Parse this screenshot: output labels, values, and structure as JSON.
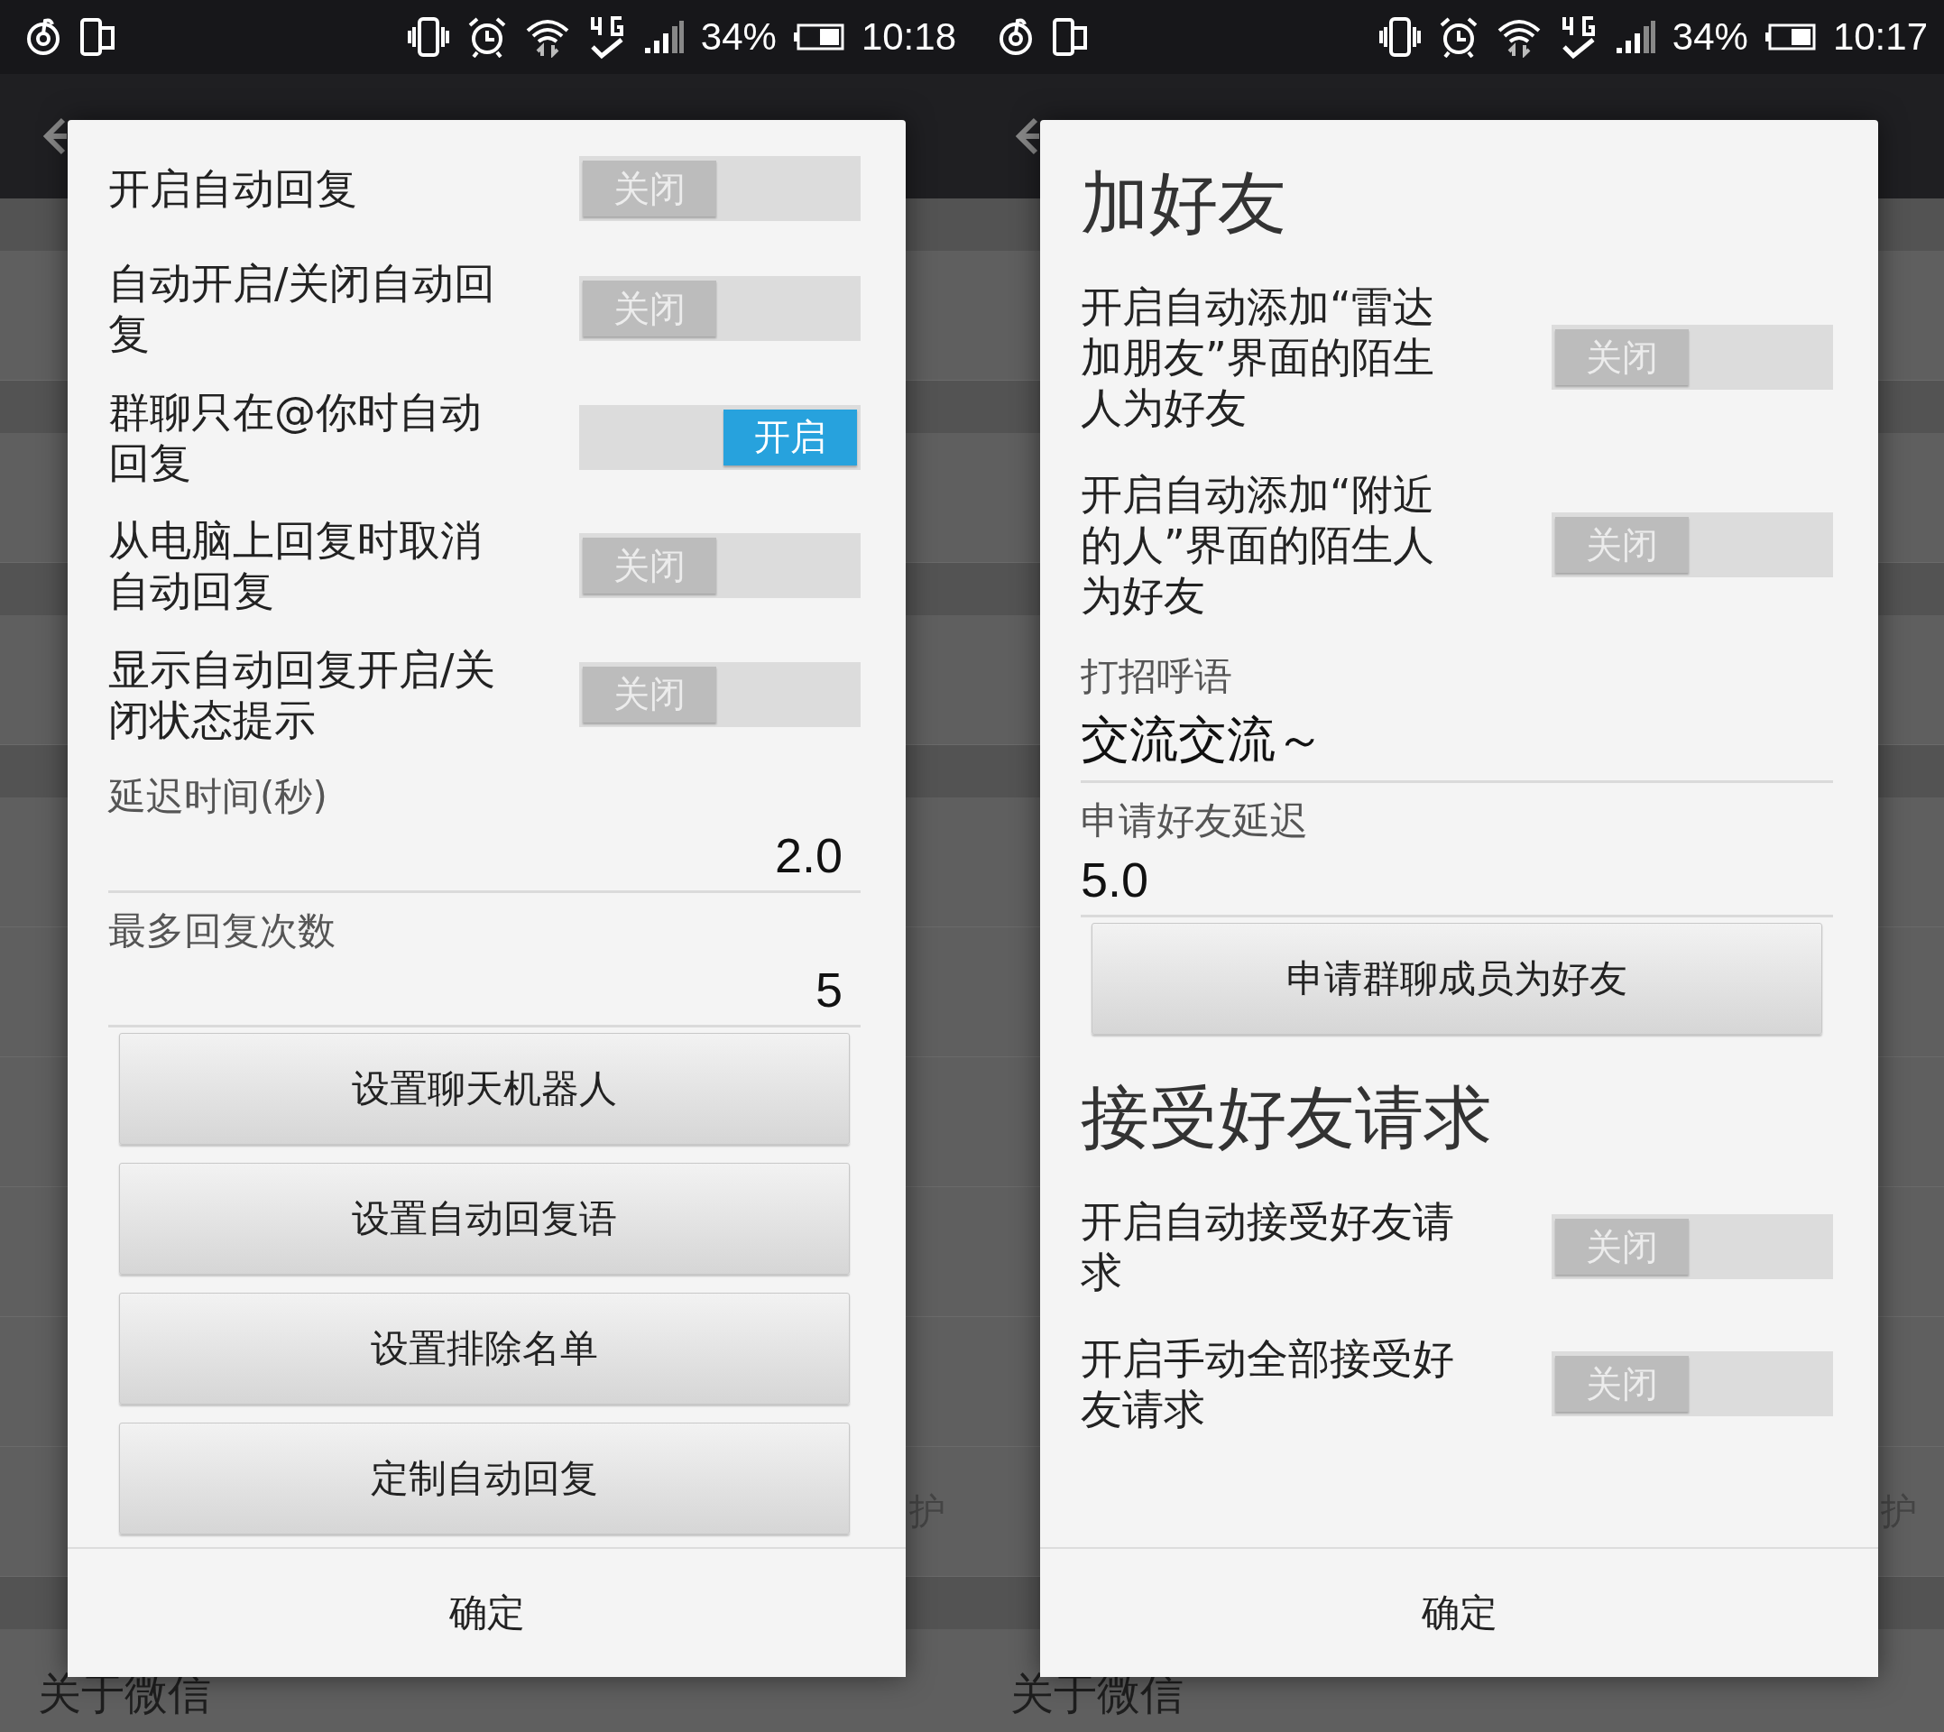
{
  "phones": [
    {
      "status_bar": {
        "battery": "34%",
        "time": "10:18"
      },
      "background": {
        "side_text": "护",
        "footer": "关于微信"
      },
      "dialog": {
        "items": [
          {
            "kind": "switch",
            "label": "开启自动回复",
            "on": false,
            "state_text": "关闭"
          },
          {
            "kind": "switch",
            "label": "自动开启/关闭自动回复",
            "on": false,
            "state_text": "关闭"
          },
          {
            "kind": "switch",
            "label": "群聊只在@你时自动回复",
            "on": true,
            "state_text": "开启"
          },
          {
            "kind": "switch",
            "label": "从电脑上回复时取消自动回复",
            "on": false,
            "state_text": "关闭"
          },
          {
            "kind": "switch",
            "label": "显示自动回复开启/关闭状态提示",
            "on": false,
            "state_text": "关闭"
          },
          {
            "kind": "number_field",
            "label": "延迟时间(秒)",
            "value": "2.0"
          },
          {
            "kind": "number_field",
            "label": "最多回复次数",
            "value": "5"
          },
          {
            "kind": "button",
            "label": "设置聊天机器人"
          },
          {
            "kind": "button",
            "label": "设置自动回复语"
          },
          {
            "kind": "button",
            "label": "设置排除名单"
          },
          {
            "kind": "button",
            "label": "定制自动回复"
          }
        ],
        "confirm": "确定"
      }
    },
    {
      "status_bar": {
        "battery": "34%",
        "time": "10:17"
      },
      "background": {
        "side_text": "护",
        "footer": "关于微信"
      },
      "dialog": {
        "items": [
          {
            "kind": "heading",
            "text": "加好友"
          },
          {
            "kind": "switch",
            "label": "开启自动添加“雷达加朋友”界面的陌生人为好友",
            "on": false,
            "state_text": "关闭"
          },
          {
            "kind": "switch",
            "label": "开启自动添加“附近的人”界面的陌生人为好友",
            "on": false,
            "state_text": "关闭"
          },
          {
            "kind": "text_field",
            "label": "打招呼语",
            "value": "交流交流～"
          },
          {
            "kind": "text_field",
            "label": "申请好友延迟",
            "value": "5.0"
          },
          {
            "kind": "button",
            "label": "申请群聊成员为好友"
          },
          {
            "kind": "heading",
            "text": "接受好友请求"
          },
          {
            "kind": "switch",
            "label": "开启自动接受好友请求",
            "on": false,
            "state_text": "关闭"
          },
          {
            "kind": "switch",
            "label": "开启手动全部接受好友请求",
            "on": false,
            "state_text": "关闭"
          }
        ],
        "confirm": "确定"
      }
    }
  ]
}
